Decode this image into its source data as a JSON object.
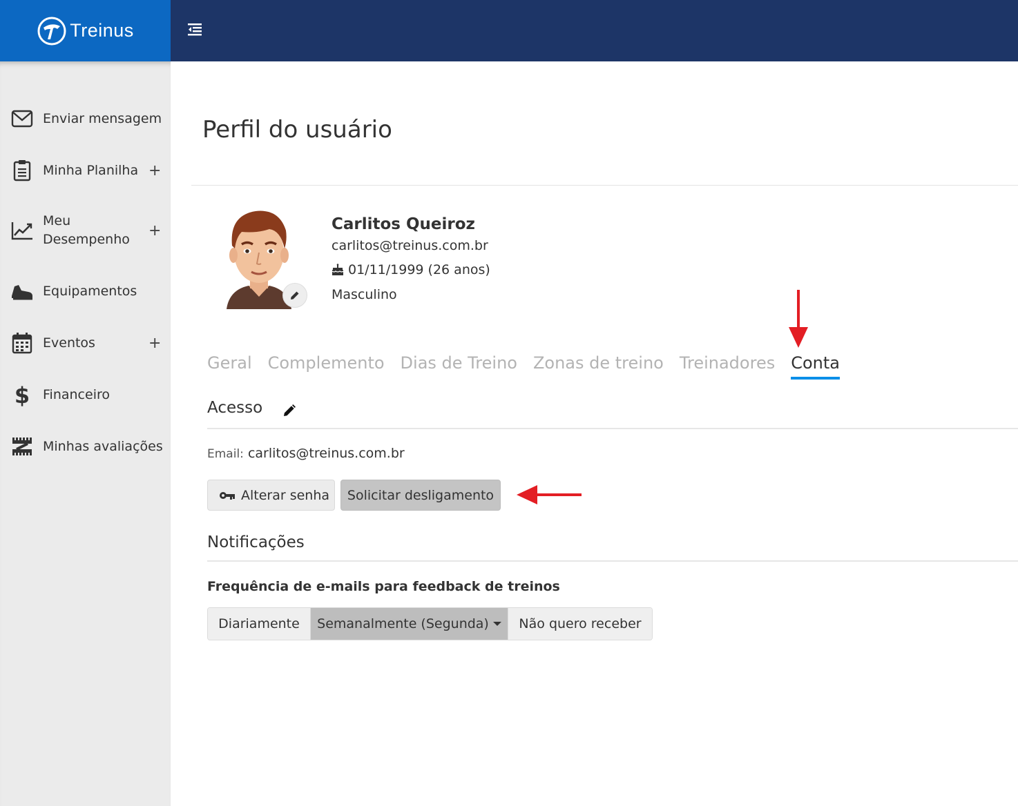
{
  "header": {
    "logo_text": "Treinus",
    "menu_toggle_icon": "menu-collapse-icon"
  },
  "sidebar": {
    "items": [
      {
        "label": "Enviar mensagem",
        "icon": "envelope-icon",
        "expandable": false
      },
      {
        "label": "Minha Planilha",
        "icon": "clipboard-icon",
        "expandable": true
      },
      {
        "label_line1": "Meu",
        "label_line2": "Desempenho",
        "icon": "chart-line-icon",
        "expandable": true
      },
      {
        "label": "Equipamentos",
        "icon": "shoe-icon",
        "expandable": false
      },
      {
        "label": "Eventos",
        "icon": "calendar-icon",
        "expandable": true
      },
      {
        "label": "Financeiro",
        "icon": "dollar-icon",
        "expandable": false
      },
      {
        "label": "Minhas avaliações",
        "icon": "tape-measure-icon",
        "expandable": false
      }
    ],
    "plus": "+"
  },
  "main": {
    "title": "Perfil do usuário",
    "user": {
      "name": "Carlitos Queiroz",
      "email": "carlitos@treinus.com.br",
      "birthday": "01/11/1999 (26 anos)",
      "gender": "Masculino"
    },
    "tabs": [
      {
        "label": "Geral",
        "active": false
      },
      {
        "label": "Complemento",
        "active": false
      },
      {
        "label": "Dias de Treino",
        "active": false
      },
      {
        "label": "Zonas de treino",
        "active": false
      },
      {
        "label": "Treinadores",
        "active": false
      },
      {
        "label": "Conta",
        "active": true
      }
    ],
    "access": {
      "title": "Acesso",
      "email_label": "Email:",
      "email_value": "carlitos@treinus.com.br",
      "change_password": "Alterar senha",
      "request_shutdown": "Solicitar desligamento"
    },
    "notifications": {
      "title": "Notificações",
      "frequency_label": "Frequência de e-mails para feedback de treinos",
      "options": [
        "Diariamente",
        "Semanalmente (Segunda)",
        "Não quero receber"
      ],
      "selected": "Semanalmente (Segunda)"
    }
  },
  "colors": {
    "header_bg": "#1d3567",
    "logo_bg": "#0c68c2",
    "sidebar_bg": "#ebebeb",
    "tab_active_underline": "#0a8fe8",
    "annotation_arrow": "#e31e24"
  }
}
